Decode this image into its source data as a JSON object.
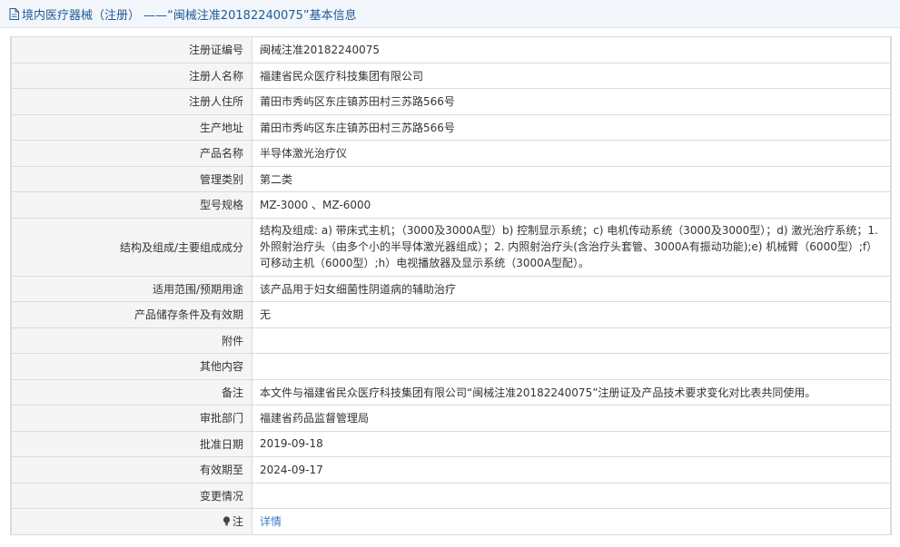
{
  "header": {
    "title": "境内医疗器械（注册）  ——“闽械注准20182240075”基本信息",
    "icon": "document-icon"
  },
  "rows": [
    {
      "label": "注册证编号",
      "value": "闽械注准20182240075"
    },
    {
      "label": "注册人名称",
      "value": "福建省民众医疗科技集团有限公司"
    },
    {
      "label": "注册人住所",
      "value": "莆田市秀屿区东庄镇苏田村三苏路566号"
    },
    {
      "label": "生产地址",
      "value": "莆田市秀屿区东庄镇苏田村三苏路566号"
    },
    {
      "label": "产品名称",
      "value": "半导体激光治疗仪"
    },
    {
      "label": "管理类别",
      "value": "第二类"
    },
    {
      "label": "型号规格",
      "value": "MZ-3000 、MZ-6000"
    },
    {
      "label": "结构及组成/主要组成成分",
      "value": "结构及组成: a) 带床式主机；（3000及3000A型）b) 控制显示系统；c) 电机传动系统（3000及3000型）；d) 激光治疗系统；1. 外照射治疗头（由多个小的半导体激光器组成）；2. 内照射治疗头(含治疗头套管、3000A有振动功能);e) 机械臂（6000型）;f）可移动主机（6000型）;h）电视播放器及显示系统（3000A型配）。"
    },
    {
      "label": "适用范围/预期用途",
      "value": "该产品用于妇女细菌性阴道病的辅助治疗"
    },
    {
      "label": "产品储存条件及有效期",
      "value": "无"
    },
    {
      "label": "附件",
      "value": ""
    },
    {
      "label": "其他内容",
      "value": ""
    },
    {
      "label": "备注",
      "value": "本文件与福建省民众医疗科技集团有限公司“闽械注准20182240075”注册证及产品技术要求变化对比表共同使用。"
    },
    {
      "label": "审批部门",
      "value": "福建省药品监督管理局"
    },
    {
      "label": "批准日期",
      "value": "2019-09-18"
    },
    {
      "label": "有效期至",
      "value": "2024-09-17"
    },
    {
      "label": "变更情况",
      "value": ""
    }
  ],
  "note": {
    "label": "注",
    "icon": "lightbulb-icon",
    "link": "详情"
  },
  "colors": {
    "header_bg": "#f3f6fb",
    "title_color": "#1f5a96",
    "label_bg": "#f5f5f5",
    "border": "#d6dce4",
    "link": "#3a7dc9"
  }
}
